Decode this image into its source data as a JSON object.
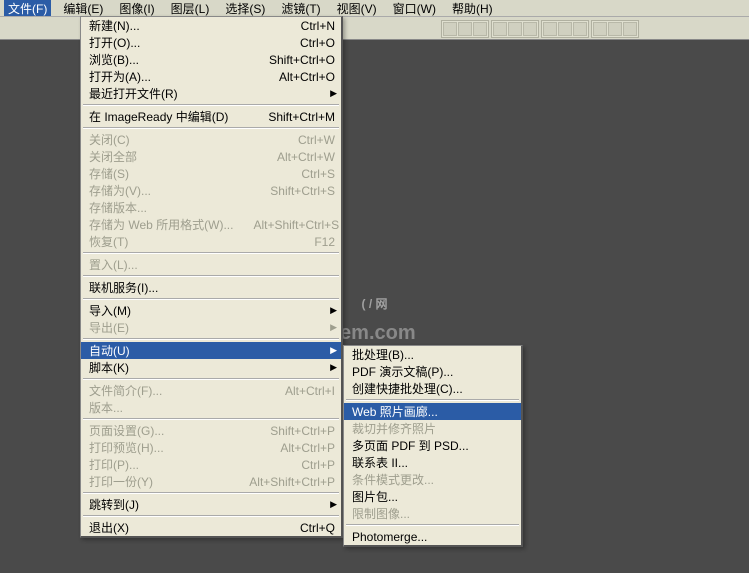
{
  "menubar": {
    "items": [
      {
        "label": "文件(F)",
        "active": true
      },
      {
        "label": "编辑(E)"
      },
      {
        "label": "图像(I)"
      },
      {
        "label": "图层(L)"
      },
      {
        "label": "选择(S)"
      },
      {
        "label": "滤镜(T)"
      },
      {
        "label": "视图(V)"
      },
      {
        "label": "窗口(W)"
      },
      {
        "label": "帮助(H)"
      }
    ]
  },
  "watermark": {
    "main": "( / 网",
    "sub": "tem.com"
  },
  "file_menu": [
    {
      "label": "新建(N)...",
      "shortcut": "Ctrl+N"
    },
    {
      "label": "打开(O)...",
      "shortcut": "Ctrl+O"
    },
    {
      "label": "浏览(B)...",
      "shortcut": "Shift+Ctrl+O"
    },
    {
      "label": "打开为(A)...",
      "shortcut": "Alt+Ctrl+O"
    },
    {
      "label": "最近打开文件(R)",
      "submenu": true
    },
    {
      "sep": true
    },
    {
      "label": "在 ImageReady 中编辑(D)",
      "shortcut": "Shift+Ctrl+M"
    },
    {
      "sep": true
    },
    {
      "label": "关闭(C)",
      "shortcut": "Ctrl+W",
      "disabled": true
    },
    {
      "label": "关闭全部",
      "shortcut": "Alt+Ctrl+W",
      "disabled": true
    },
    {
      "label": "存储(S)",
      "shortcut": "Ctrl+S",
      "disabled": true
    },
    {
      "label": "存储为(V)...",
      "shortcut": "Shift+Ctrl+S",
      "disabled": true
    },
    {
      "label": "存储版本...",
      "disabled": true
    },
    {
      "label": "存储为 Web 所用格式(W)...",
      "shortcut": "Alt+Shift+Ctrl+S",
      "disabled": true
    },
    {
      "label": "恢复(T)",
      "shortcut": "F12",
      "disabled": true
    },
    {
      "sep": true
    },
    {
      "label": "置入(L)...",
      "disabled": true
    },
    {
      "sep": true
    },
    {
      "label": "联机服务(I)..."
    },
    {
      "sep": true
    },
    {
      "label": "导入(M)",
      "submenu": true
    },
    {
      "label": "导出(E)",
      "submenu": true,
      "disabled": true
    },
    {
      "sep": true
    },
    {
      "label": "自动(U)",
      "submenu": true,
      "highlight": true
    },
    {
      "label": "脚本(K)",
      "submenu": true
    },
    {
      "sep": true
    },
    {
      "label": "文件简介(F)...",
      "shortcut": "Alt+Ctrl+I",
      "disabled": true
    },
    {
      "label": "版本...",
      "disabled": true
    },
    {
      "sep": true
    },
    {
      "label": "页面设置(G)...",
      "shortcut": "Shift+Ctrl+P",
      "disabled": true
    },
    {
      "label": "打印预览(H)...",
      "shortcut": "Alt+Ctrl+P",
      "disabled": true
    },
    {
      "label": "打印(P)...",
      "shortcut": "Ctrl+P",
      "disabled": true
    },
    {
      "label": "打印一份(Y)",
      "shortcut": "Alt+Shift+Ctrl+P",
      "disabled": true
    },
    {
      "sep": true
    },
    {
      "label": "跳转到(J)",
      "submenu": true
    },
    {
      "sep": true
    },
    {
      "label": "退出(X)",
      "shortcut": "Ctrl+Q"
    }
  ],
  "auto_submenu": [
    {
      "label": "批处理(B)..."
    },
    {
      "label": "PDF 演示文稿(P)..."
    },
    {
      "label": "创建快捷批处理(C)..."
    },
    {
      "sep": true
    },
    {
      "label": "Web 照片画廊...",
      "highlight": true
    },
    {
      "label": "裁切并修齐照片",
      "disabled": true
    },
    {
      "label": "多页面 PDF 到 PSD..."
    },
    {
      "label": "联系表 II..."
    },
    {
      "label": "条件模式更改...",
      "disabled": true
    },
    {
      "label": "图片包..."
    },
    {
      "label": "限制图像...",
      "disabled": true
    },
    {
      "sep": true
    },
    {
      "label": "Photomerge..."
    }
  ]
}
